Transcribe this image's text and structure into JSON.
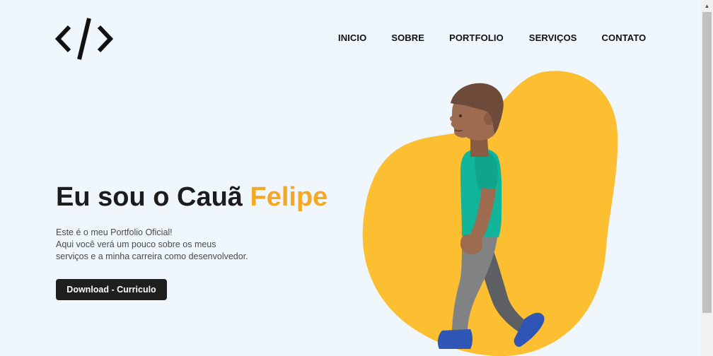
{
  "header": {
    "logo_icon": "code-brackets-icon",
    "nav": [
      {
        "label": "INICIO"
      },
      {
        "label": "SOBRE"
      },
      {
        "label": "PORTFOLIO"
      },
      {
        "label": "SERVIÇOS"
      },
      {
        "label": "CONTATO"
      }
    ]
  },
  "hero": {
    "title_prefix": "Eu sou o Cauã ",
    "title_accent": "Felipe",
    "description_lines": [
      "Este é o meu Portfolio Oficial!",
      "Aqui você verá um pouco sobre os meus",
      "serviços e a minha carreira como desenvolvedor."
    ],
    "download_label": "Download - Curriculo"
  },
  "illustration": {
    "icon": "walking-person-illustration",
    "blob_color": "#fcbf31"
  },
  "colors": {
    "background": "#eff7fd",
    "accent": "#f6a724",
    "button_bg": "#1f1f1f"
  },
  "scrollbar": {
    "up_icon": "scroll-up-arrow-icon"
  }
}
